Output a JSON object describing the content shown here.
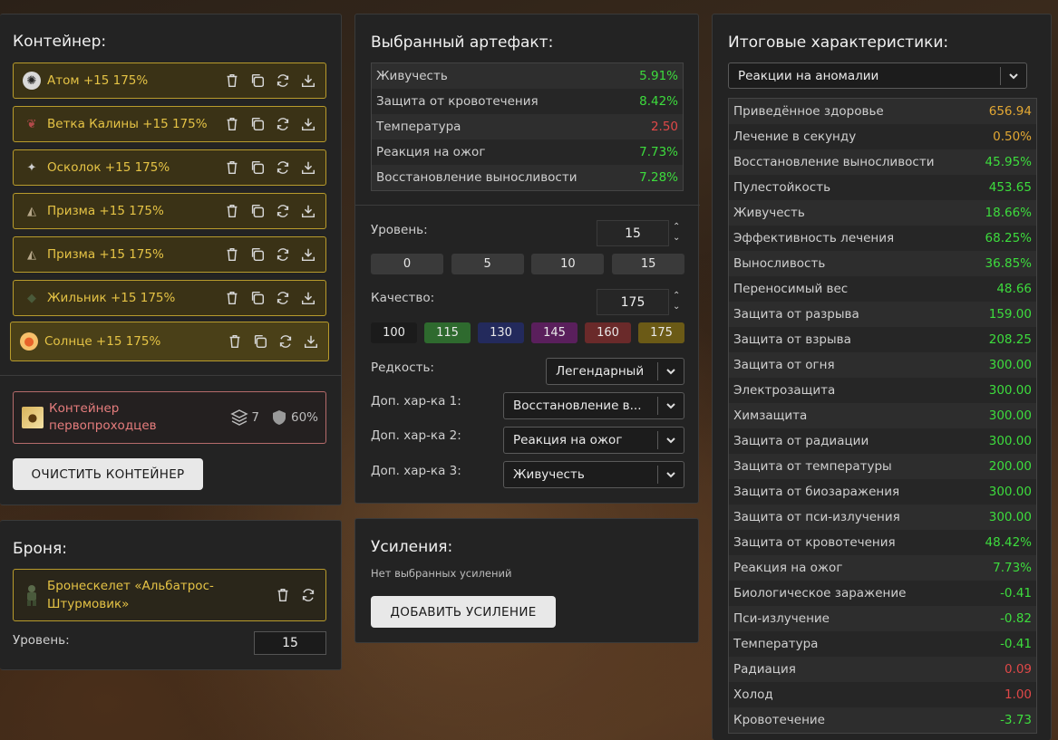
{
  "colors": {
    "gold_border": "#b89b2c",
    "gold_text": "#e5c345",
    "red_text": "#e67d7d",
    "green_value": "#3ddc3d",
    "red_value": "#e04848",
    "orange_value": "#e3a833"
  },
  "container": {
    "title": "Контейнер:",
    "items": [
      {
        "name": "Атом +15 175%",
        "icon": "atom-icon"
      },
      {
        "name": "Ветка Калины +15 175%",
        "icon": "branch-icon"
      },
      {
        "name": "Осколок +15 175%",
        "icon": "shard-icon"
      },
      {
        "name": "Призма +15 175%",
        "icon": "prism-icon"
      },
      {
        "name": "Призма +15 175%",
        "icon": "prism-icon"
      },
      {
        "name": "Жильник +15 175%",
        "icon": "vein-icon"
      },
      {
        "name": "Солнце +15 175%",
        "icon": "sun-icon"
      }
    ],
    "card": {
      "name": "Контейнер первопроходцев",
      "slots": "7",
      "protection": "60%"
    },
    "clear_button": "ОЧИСТИТЬ КОНТЕЙНЕР"
  },
  "armor": {
    "title": "Броня:",
    "name": "Бронескелет «Альбатрос-Штурмовик»",
    "level_label": "Уровень:",
    "level_value": "15"
  },
  "artifact": {
    "title": "Выбранный артефакт:",
    "stats": [
      {
        "name": "Живучесть",
        "value": "5.91%",
        "color": "green"
      },
      {
        "name": "Защита от кровотечения",
        "value": "8.42%",
        "color": "green"
      },
      {
        "name": "Температура",
        "value": "2.50",
        "color": "red"
      },
      {
        "name": "Реакция на ожог",
        "value": "7.73%",
        "color": "green"
      },
      {
        "name": "Восстановление выносливости",
        "value": "7.28%",
        "color": "green"
      }
    ],
    "level_label": "Уровень:",
    "level_value": "15",
    "level_presets": [
      "0",
      "5",
      "10",
      "15"
    ],
    "quality_label": "Качество:",
    "quality_value": "175",
    "quality_presets": [
      {
        "label": "100",
        "color": "#1b1b1b"
      },
      {
        "label": "115",
        "color": "#2e6a2e"
      },
      {
        "label": "130",
        "color": "#232a5c"
      },
      {
        "label": "145",
        "color": "#5a1f5c"
      },
      {
        "label": "160",
        "color": "#6a2a2a"
      },
      {
        "label": "175",
        "color": "#6b5a16"
      }
    ],
    "rarity_label": "Редкость:",
    "rarity_value": "Легендарный",
    "extra1_label": "Доп. хар-ка 1:",
    "extra1_value": "Восстановление в...",
    "extra2_label": "Доп. хар-ка 2:",
    "extra2_value": "Реакция на ожог",
    "extra3_label": "Доп. хар-ка 3:",
    "extra3_value": "Живучесть"
  },
  "boosts": {
    "title": "Усиления:",
    "empty_text": "Нет выбранных усилений",
    "add_button": "ДОБАВИТЬ УСИЛЕНИЕ"
  },
  "totals": {
    "title": "Итоговые характеристики:",
    "filter_value": "Реакции на аномалии",
    "rows": [
      {
        "name": "Приведённое здоровье",
        "value": "656.94",
        "color": "orange"
      },
      {
        "name": "Лечение в секунду",
        "value": "0.50%",
        "color": "orange"
      },
      {
        "name": "Восстановление выносливости",
        "value": "45.95%",
        "color": "green"
      },
      {
        "name": "Пулестойкость",
        "value": "453.65",
        "color": "green"
      },
      {
        "name": "Живучесть",
        "value": "18.66%",
        "color": "green"
      },
      {
        "name": "Эффективность лечения",
        "value": "68.25%",
        "color": "green"
      },
      {
        "name": "Выносливость",
        "value": "36.85%",
        "color": "green"
      },
      {
        "name": "Переносимый вес",
        "value": "48.66",
        "color": "green"
      },
      {
        "name": "Защита от разрыва",
        "value": "159.00",
        "color": "green"
      },
      {
        "name": "Защита от взрыва",
        "value": "208.25",
        "color": "green"
      },
      {
        "name": "Защита от огня",
        "value": "300.00",
        "color": "green"
      },
      {
        "name": "Электрозащита",
        "value": "300.00",
        "color": "green"
      },
      {
        "name": "Химзащита",
        "value": "300.00",
        "color": "green"
      },
      {
        "name": "Защита от радиации",
        "value": "300.00",
        "color": "green"
      },
      {
        "name": "Защита от температуры",
        "value": "200.00",
        "color": "green"
      },
      {
        "name": "Защита от биозаражения",
        "value": "300.00",
        "color": "green"
      },
      {
        "name": "Защита от пси-излучения",
        "value": "300.00",
        "color": "green"
      },
      {
        "name": "Защита от кровотечения",
        "value": "48.42%",
        "color": "green"
      },
      {
        "name": "Реакция на ожог",
        "value": "7.73%",
        "color": "green"
      },
      {
        "name": "Биологическое заражение",
        "value": "-0.41",
        "color": "green"
      },
      {
        "name": "Пси-излучение",
        "value": "-0.82",
        "color": "green"
      },
      {
        "name": "Температура",
        "value": "-0.41",
        "color": "green"
      },
      {
        "name": "Радиация",
        "value": "0.09",
        "color": "red"
      },
      {
        "name": "Холод",
        "value": "1.00",
        "color": "red"
      },
      {
        "name": "Кровотечение",
        "value": "-3.73",
        "color": "green"
      }
    ]
  }
}
